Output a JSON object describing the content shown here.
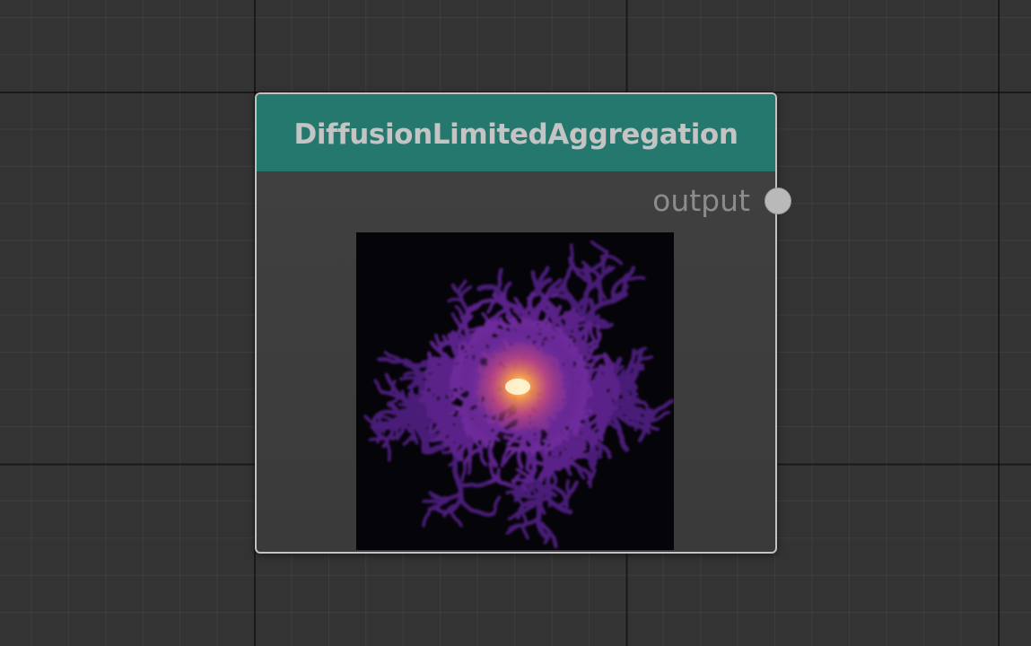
{
  "node": {
    "title": "DiffusionLimitedAggregation",
    "output_label": "output",
    "header_color": "#25786e",
    "socket_color": "#b9b9b9",
    "preview_icon": "dla-fractal-image",
    "preview_palette": [
      "#050408",
      "#3a1560",
      "#6b2f9a",
      "#b9408f",
      "#ef7a3c",
      "#fde8a6"
    ]
  }
}
